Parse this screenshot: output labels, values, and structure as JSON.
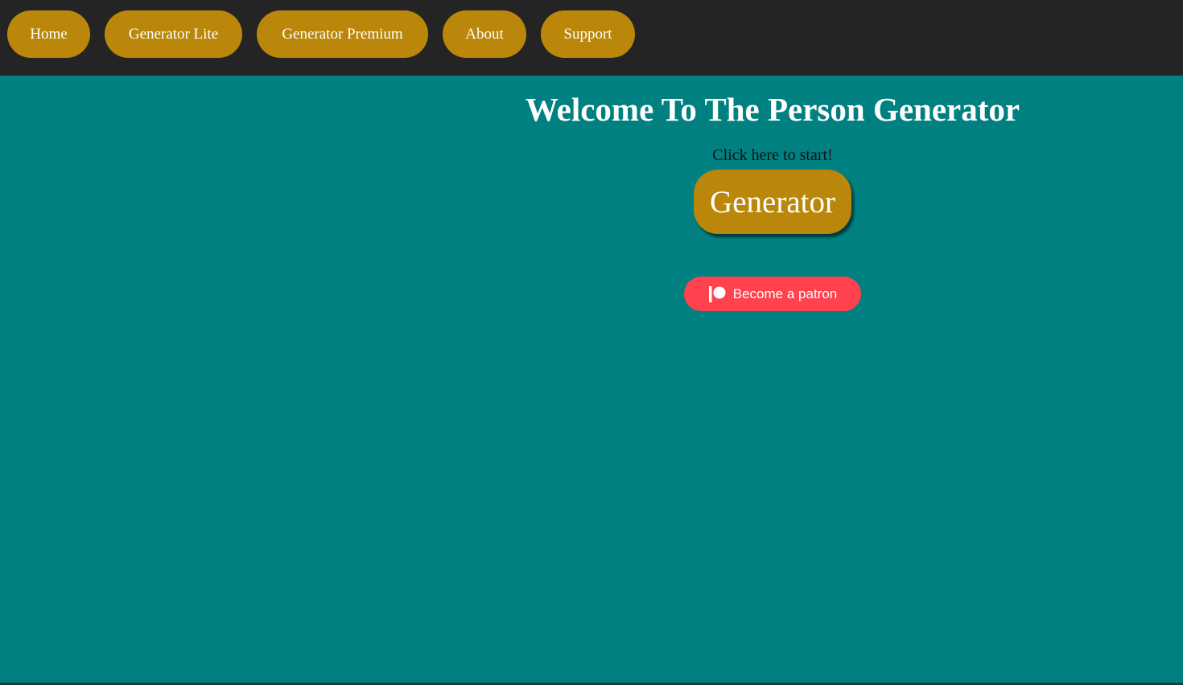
{
  "nav": {
    "items": [
      {
        "label": "Home"
      },
      {
        "label": "Generator Lite"
      },
      {
        "label": "Generator Premium"
      },
      {
        "label": "About"
      },
      {
        "label": "Support"
      }
    ]
  },
  "main": {
    "title": "Welcome To The Person Generator",
    "start_text": "Click here to start!",
    "generator_label": "Generator",
    "patron_label": "Become a patron",
    "patron_icon": "patreon-icon"
  },
  "colors": {
    "page_background": "#008080",
    "nav_background": "#242424",
    "button_gold": "#BA870A",
    "patron_red": "#FF424D",
    "text_white": "#FFFFFF"
  }
}
